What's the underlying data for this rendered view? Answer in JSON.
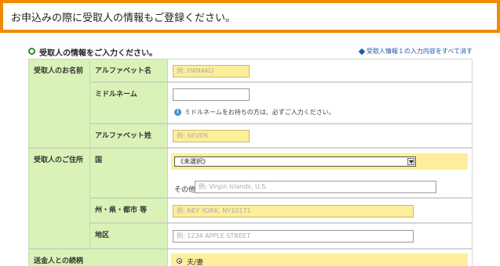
{
  "banner": {
    "text": "お申込みの際に受取人の情報もご登録ください。"
  },
  "section": {
    "title": "受取人の情報をご入力ください。",
    "clear_link": "受取人情報１の入力内容をすべて消す"
  },
  "name_group": {
    "label": "受取人のお名前",
    "first_name": {
      "label": "アルファベット名",
      "placeholder": "例: HANAKO"
    },
    "middle_name": {
      "label": "ミドルネーム",
      "value": "",
      "note": "ミドルネームをお持ちの方は、必ずご入力ください。"
    },
    "last_name": {
      "label": "アルファベット姓",
      "placeholder": "例: SEVEN"
    }
  },
  "address_group": {
    "label": "受取人のご住所",
    "country": {
      "label": "国",
      "selected": "《未選択》",
      "other_label": "その他",
      "other_placeholder": "例: Virgin Islands, U.S."
    },
    "state": {
      "label": "州・県・都市 等",
      "placeholder": "例: NEY YORK, NY10171"
    },
    "district": {
      "label": "地区",
      "placeholder": "例: 1234 APPLE STREET"
    }
  },
  "relationship_group": {
    "label": "送金人との続柄",
    "option_1": "夫/妻"
  },
  "colors": {
    "accent": "#f08a00",
    "label_bg": "#d9f2b8",
    "required_bg": "#fdef9a",
    "link": "#1a5aa8"
  }
}
